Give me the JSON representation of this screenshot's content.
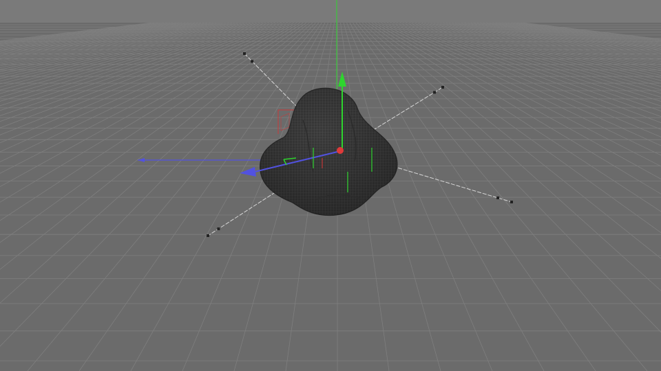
{
  "viewport": {
    "view": "perspective",
    "background_color": "#6b6b6b",
    "sky_color": "#7a7a7a",
    "grid_color": "#7f7f7f",
    "grid_visible": true
  },
  "object": {
    "type": "deformed-sphere-mesh",
    "display": "wireframe-shaded",
    "mesh_color": "#3c3c3c",
    "wire_color": "#585858",
    "selected": true
  },
  "gizmo": {
    "x_axis_color": "#5252e0",
    "y_axis_color": "#2ed52e",
    "center_color": "#e03a3a",
    "deformer_handle_count": 4,
    "deformer_color": "#d8d8d8"
  }
}
